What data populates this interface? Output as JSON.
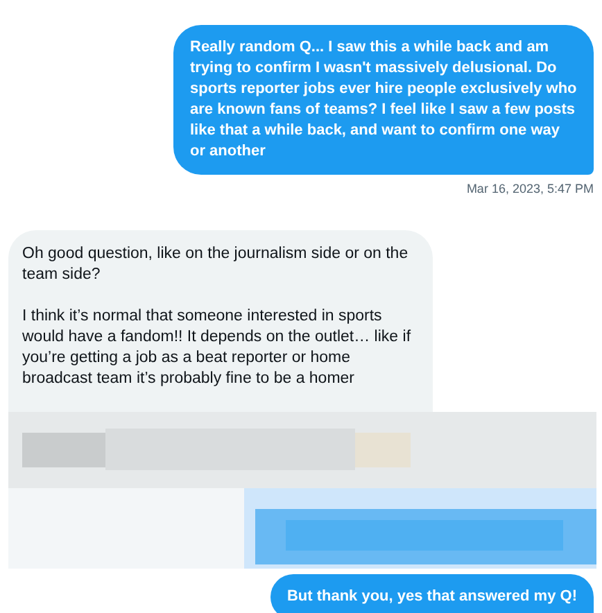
{
  "messages": [
    {
      "kind": "sent",
      "paragraphs": [
        "Really random Q... I saw this a while back and am trying to confirm I wasn't massively delusional. Do sports reporter jobs ever hire people exclusively who are known fans of teams? I feel like I saw a few posts like that a while back, and want to confirm one way or another"
      ],
      "timestamp": "Mar 16, 2023, 5:47 PM"
    },
    {
      "kind": "received",
      "paragraphs": [
        "Oh good question, like on the journalism side or on the team side?",
        "I think it’s normal that someone interested in sports would have a fandom!! It depends on the outlet… like if you’re getting a job as a beat reporter or home broadcast team it’s probably fine to be a homer"
      ]
    },
    {
      "kind": "redacted"
    },
    {
      "kind": "sent",
      "paragraphs": [
        "But thank you, yes that answered my Q!"
      ]
    }
  ]
}
